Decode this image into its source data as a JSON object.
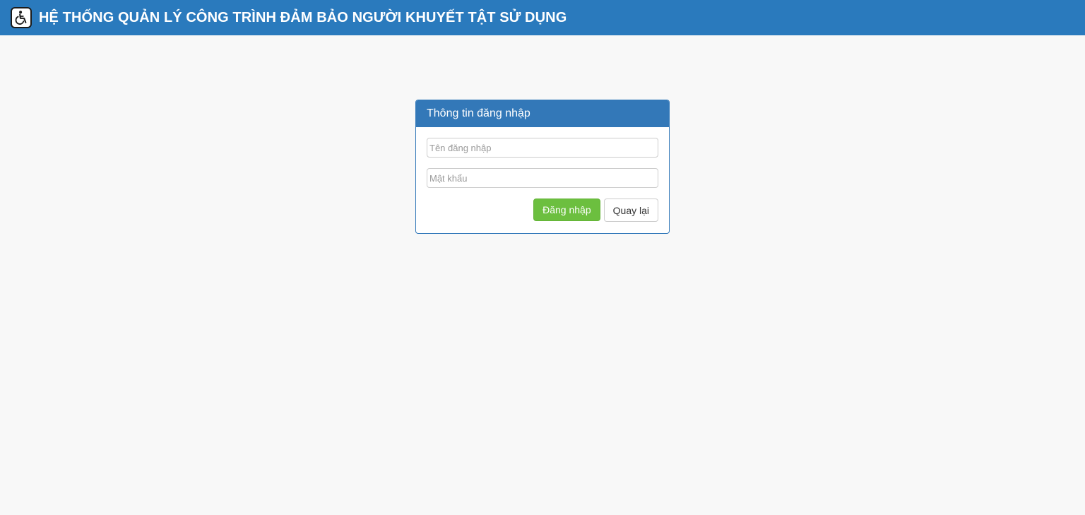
{
  "header": {
    "title": "HỆ THỐNG QUẢN LÝ CÔNG TRÌNH ĐẢM BẢO NGƯỜI KHUYẾT TẬT SỬ DỤNG",
    "logo_icon": "wheelchair-icon",
    "background_color": "#2a7abd"
  },
  "login": {
    "heading": "Thông tin đăng nhập",
    "username_placeholder": "Tên đăng nhập",
    "username_value": "",
    "password_placeholder": "Mật khẩu",
    "password_value": "",
    "login_button": "Đăng nhập",
    "back_button": "Quay lại",
    "heading_color": "#3378b8",
    "login_button_color": "#6cbf3f"
  }
}
